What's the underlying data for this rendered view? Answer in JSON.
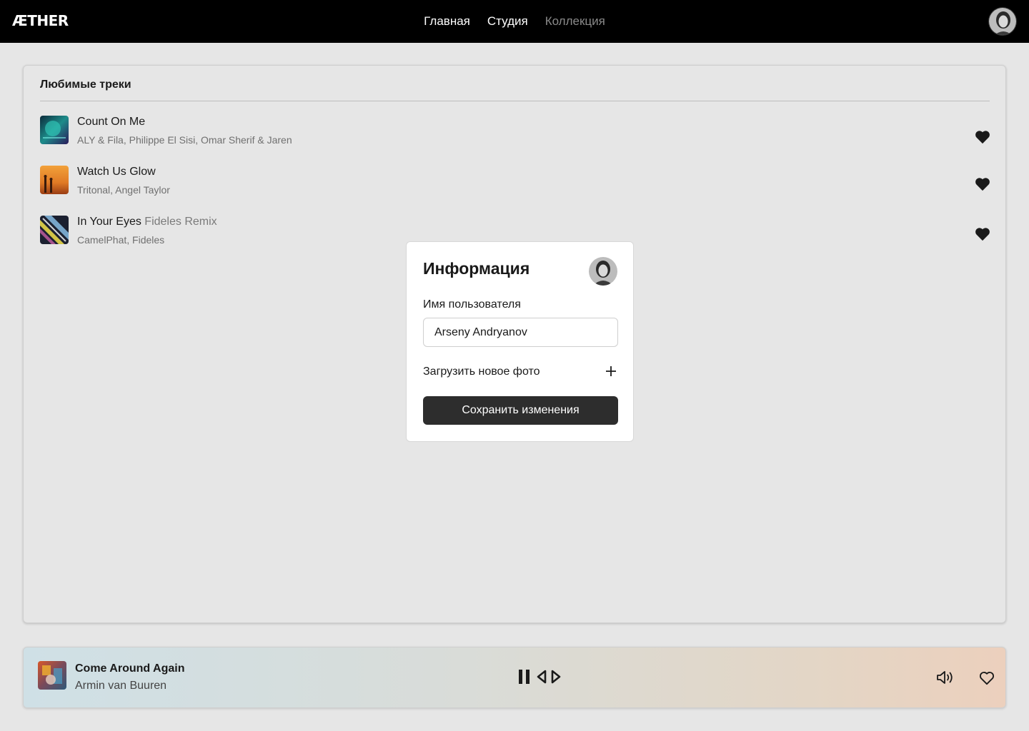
{
  "app": {
    "logo": "ÆTHER"
  },
  "nav": {
    "items": [
      {
        "label": "Главная",
        "active": true
      },
      {
        "label": "Студия",
        "active": true
      },
      {
        "label": "Коллекция",
        "active": false
      }
    ]
  },
  "favorites": {
    "title": "Любимые треки",
    "tracks": [
      {
        "title": "Count On Me",
        "remix": "",
        "artists": "ALY & Fila, Philippe El Sisi, Omar Sherif & Jaren",
        "liked": true
      },
      {
        "title": "Watch Us Glow",
        "remix": "",
        "artists": "Tritonal, Angel Taylor",
        "liked": true
      },
      {
        "title": "In Your Eyes",
        "remix": "Fideles Remix",
        "artists": "CamelPhat, Fideles",
        "liked": true
      }
    ]
  },
  "modal": {
    "title": "Информация",
    "username_label": "Имя пользователя",
    "username_value": "Arseny Andryanov",
    "upload_label": "Загрузить новое фото",
    "save_label": "Сохранить изменения"
  },
  "player": {
    "title": "Come Around Again",
    "artist": "Armin van Buuren",
    "state": "playing"
  },
  "icons": {
    "heart": "heart-icon",
    "plus": "plus-icon",
    "pause": "pause-icon",
    "prev": "prev-icon",
    "next": "next-icon",
    "volume": "volume-icon",
    "like": "heart-outline-icon"
  }
}
